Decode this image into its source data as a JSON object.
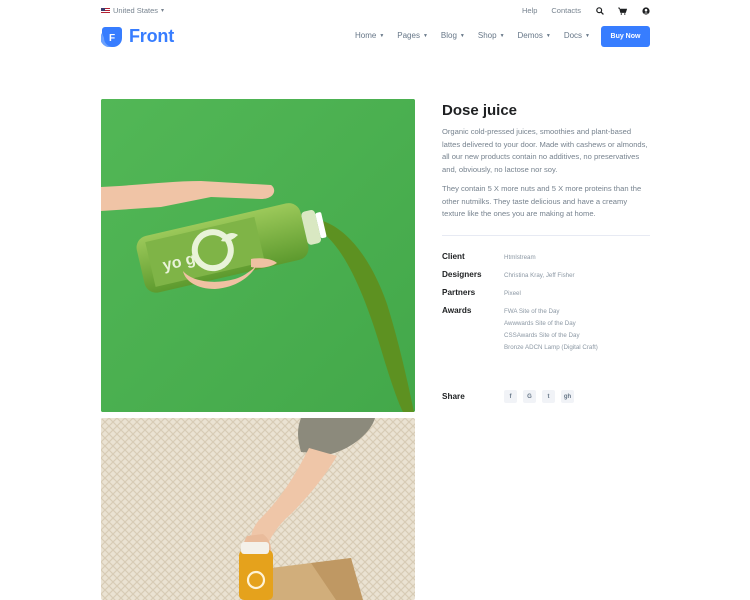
{
  "topbar": {
    "country": "United States",
    "links": [
      "Help",
      "Contacts"
    ],
    "icons": [
      "search-icon",
      "cart-icon",
      "user-icon"
    ]
  },
  "header": {
    "logo_letter": "F",
    "logo_text": "Front",
    "nav": [
      "Home",
      "Pages",
      "Blog",
      "Shop",
      "Demos",
      "Docs"
    ],
    "cta": "Buy Now"
  },
  "project": {
    "title": "Dose juice",
    "description_1": "Organic cold-pressed juices, smoothies and plant-based lattes delivered to your door. Made with cashews or almonds, all our new products contain no additives, no preservatives and, obviously, no lactose nor soy.",
    "description_2": "They contain 5 X more nuts and 5 X more proteins than the other nutmilks. They taste delicious and have a creamy texture like the ones you are making at home.",
    "client_label": "Client",
    "client": "Htmlstream",
    "designers_label": "Designers",
    "designers": "Christina Kray, Jeff Fisher",
    "partners_label": "Partners",
    "partners": "Pixeel",
    "awards_label": "Awards",
    "awards": [
      "FWA Site of the Day",
      "Awwwards Site of the Day",
      "CSSAwards Site of the Day",
      "Bronze ADCN Lamp (Digital Craft)"
    ],
    "share_label": "Share",
    "share_icons": [
      "f",
      "G",
      "t",
      "gh"
    ],
    "bottle_text": "yo gi"
  },
  "colors": {
    "accent": "#377dff",
    "green": "#4fb554"
  }
}
